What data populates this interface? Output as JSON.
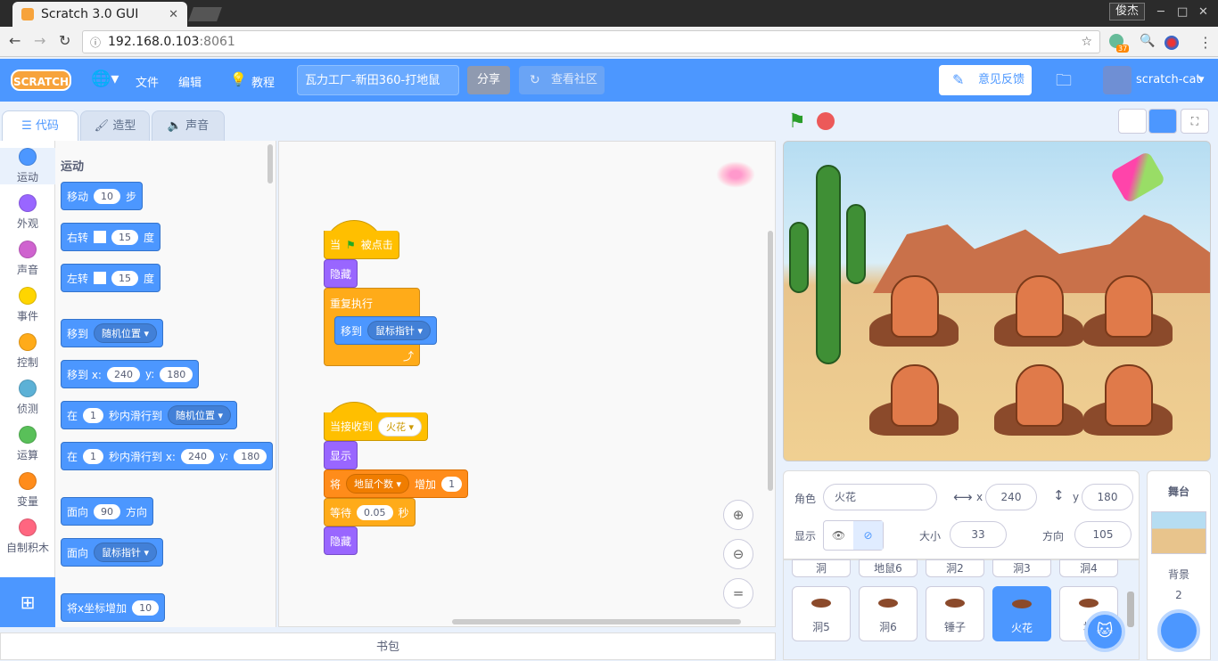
{
  "browser": {
    "tab_title": "Scratch 3.0 GUI",
    "user": "俊杰",
    "url_host": "192.168.0.103",
    "url_port": ":8061",
    "badge_count": "37"
  },
  "menu": {
    "logo": "SCRATCH",
    "file": "文件",
    "edit": "编辑",
    "tutorials": "教程",
    "project_name": "瓦力工厂-新田360-打地鼠",
    "share": "分享",
    "community": "查看社区",
    "feedback": "意见反馈",
    "username": "scratch-cat",
    "accent": "#4c97ff"
  },
  "tabs": {
    "code": "代码",
    "costumes": "造型",
    "sounds": "声音"
  },
  "categories": [
    {
      "label": "运动",
      "color": "#4c97ff"
    },
    {
      "label": "外观",
      "color": "#9966ff"
    },
    {
      "label": "声音",
      "color": "#cf63cf"
    },
    {
      "label": "事件",
      "color": "#ffd500"
    },
    {
      "label": "控制",
      "color": "#ffab19"
    },
    {
      "label": "侦测",
      "color": "#5cb1d6"
    },
    {
      "label": "运算",
      "color": "#59c059"
    },
    {
      "label": "变量",
      "color": "#ff8c1a"
    },
    {
      "label": "自制积木",
      "color": "#ff6680"
    }
  ],
  "palette": {
    "heading": "运动",
    "move": {
      "a": "移动",
      "v": "10",
      "b": "步"
    },
    "turn_right": {
      "a": "右转",
      "v": "15",
      "b": "度"
    },
    "turn_left": {
      "a": "左转",
      "v": "15",
      "b": "度"
    },
    "goto": {
      "a": "移到",
      "d": "随机位置"
    },
    "goto_xy": {
      "a": "移到 x:",
      "x": "240",
      "b": "y:",
      "y": "180"
    },
    "glide": {
      "a": "在",
      "v": "1",
      "b": "秒内滑行到",
      "d": "随机位置"
    },
    "glide_xy": {
      "a": "在",
      "v": "1",
      "b": "秒内滑行到 x:",
      "x": "240",
      "c": "y:",
      "y": "180"
    },
    "point_dir": {
      "a": "面向",
      "v": "90",
      "b": "方向"
    },
    "point_to": {
      "a": "面向",
      "d": "鼠标指针"
    },
    "change_x": {
      "a": "将x坐标增加",
      "v": "10"
    }
  },
  "script1": {
    "when_flag": "当",
    "clicked": "被点击",
    "hide": "隐藏",
    "forever": "重复执行",
    "goto": "移到",
    "goto_d": "鼠标指针"
  },
  "script2": {
    "when_receive": "当接收到",
    "msg": "火花",
    "show": "显示",
    "set_a": "将",
    "var": "地鼠个数",
    "set_b": "增加",
    "val": "1",
    "wait_a": "等待",
    "wait_v": "0.05",
    "wait_b": "秒",
    "hide": "隐藏"
  },
  "backpack": "书包",
  "sprite": {
    "label": "角色",
    "name": "火花",
    "x_label": "x",
    "x": "240",
    "y_label": "y",
    "y": "180",
    "show": "显示",
    "size_label": "大小",
    "size": "33",
    "dir_label": "方向",
    "dir": "105"
  },
  "sprites_row1": [
    "洞",
    "地鼠6",
    "洞2",
    "洞3",
    "洞4"
  ],
  "sprites_row2": [
    "洞5",
    "洞6",
    "锤子",
    "火花",
    "地"
  ],
  "stage_panel": {
    "title": "舞台",
    "backdrops_label": "背景",
    "count": "2"
  }
}
